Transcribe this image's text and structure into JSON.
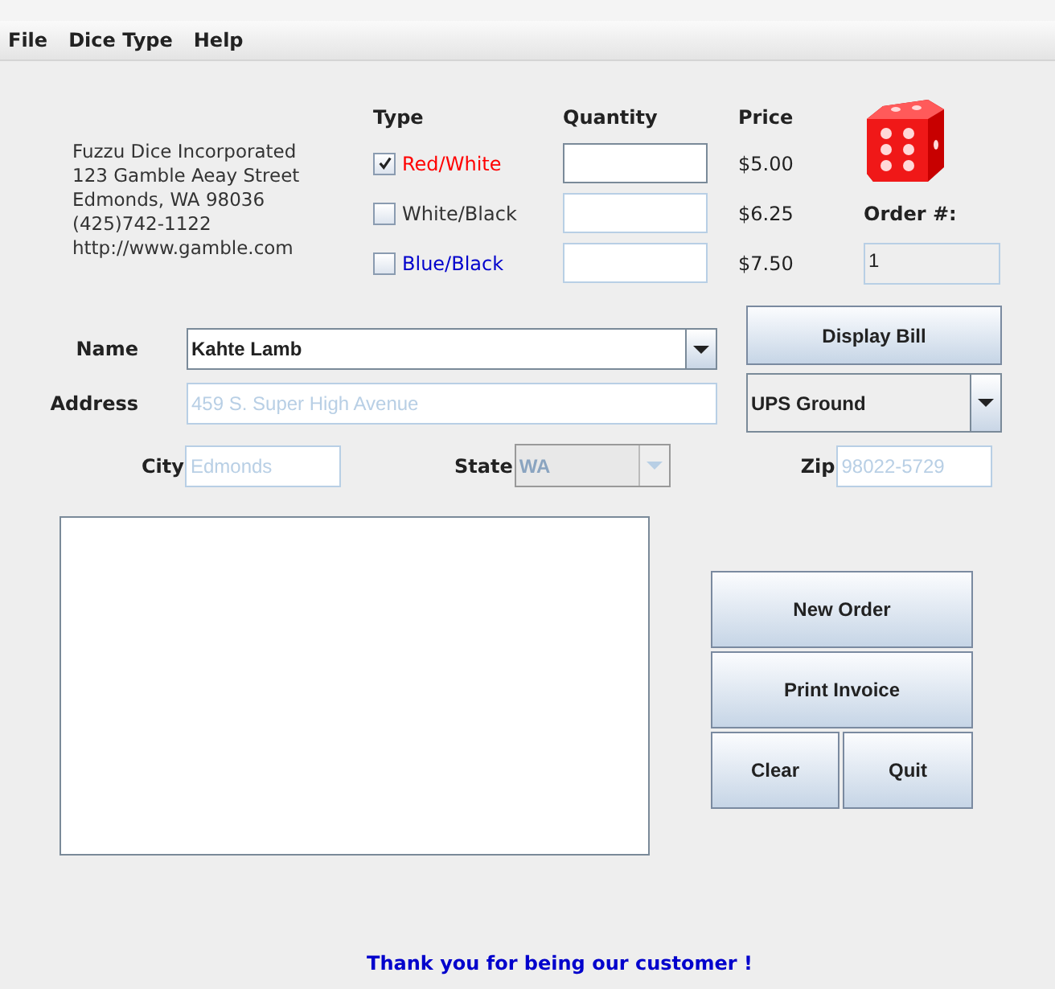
{
  "menu": [
    {
      "label": "File"
    },
    {
      "label": "Dice Type"
    },
    {
      "label": "Help"
    }
  ],
  "company": [
    "Fuzzu Dice Incorporated",
    "123 Gamble Aeay Street",
    "Edmonds, WA 98036",
    "(425)742-1122",
    "http://www.gamble.com"
  ],
  "headers": {
    "type": "Type",
    "quantity": "Quantity",
    "price": "Price"
  },
  "dice": [
    {
      "label": "Red/White",
      "color": "#ff0000",
      "checked": true,
      "price": "$5.00"
    },
    {
      "label": "White/Black",
      "color": "#333333",
      "checked": false,
      "price": "$6.25"
    },
    {
      "label": "Blue/Black",
      "color": "#0000cc",
      "checked": false,
      "price": "$7.50"
    }
  ],
  "order": {
    "label": "Order #:",
    "number": "1"
  },
  "customer": {
    "name_label": "Name",
    "name": "Kahte Lamb",
    "address_label": "Address",
    "address": "459 S. Super High Avenue",
    "city_label": "City",
    "city": "Edmonds",
    "state_label": "State",
    "state": "WA",
    "zip_label": "Zip",
    "zip": "98022-5729",
    "disabled": true
  },
  "shipping": "UPS Ground",
  "display_bill": "Display Bill",
  "new_order": "New Order",
  "print_invoice": "Print Invoice",
  "clear": "Clear",
  "quit": "Quit",
  "footer": "Thank you for being our customer !"
}
